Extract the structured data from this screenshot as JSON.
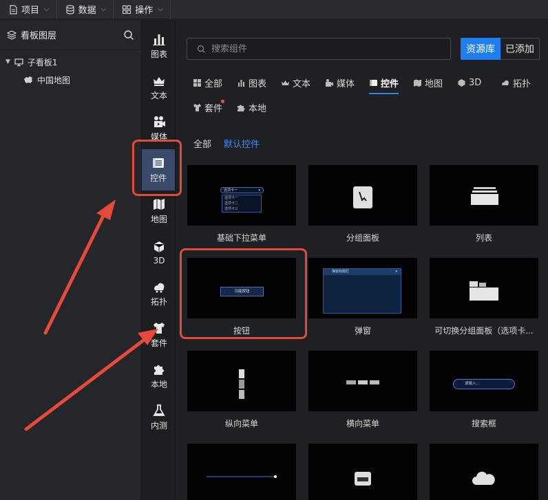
{
  "menubar": {
    "items": [
      {
        "label": "项目",
        "icon": "document-icon"
      },
      {
        "label": "数据",
        "icon": "database-icon"
      },
      {
        "label": "操作",
        "icon": "grid-icon"
      }
    ]
  },
  "layers": {
    "title": "看板图层",
    "tree": [
      {
        "label": "子看板1",
        "icon": "monitor-icon",
        "expanded": true
      },
      {
        "label": "中国地图",
        "icon": "china-map-icon"
      }
    ]
  },
  "rail": {
    "items": [
      {
        "label": "图表",
        "icon": "bar-chart-icon"
      },
      {
        "label": "文本",
        "icon": "crown-text-icon"
      },
      {
        "label": "媒体",
        "icon": "media-icon"
      },
      {
        "label": "控件",
        "icon": "widget-icon",
        "active": true
      },
      {
        "label": "地图",
        "icon": "map-icon"
      },
      {
        "label": "3D",
        "icon": "cube-icon"
      },
      {
        "label": "拓扑",
        "icon": "topology-icon"
      },
      {
        "label": "套件",
        "icon": "shirt-icon"
      },
      {
        "label": "本地",
        "icon": "puzzle-icon"
      },
      {
        "label": "内测",
        "icon": "flask-icon"
      }
    ]
  },
  "search": {
    "placeholder": "搜索组件"
  },
  "source_toggle": {
    "library": "资源库",
    "added": "已添加"
  },
  "tabs": [
    {
      "label": "全部"
    },
    {
      "label": "图表"
    },
    {
      "label": "文本"
    },
    {
      "label": "媒体"
    },
    {
      "label": "控件",
      "active": true
    },
    {
      "label": "地图"
    },
    {
      "label": "3D"
    },
    {
      "label": "拓扑"
    },
    {
      "label": "套件",
      "badge": true
    },
    {
      "label": "本地"
    }
  ],
  "subtabs": [
    {
      "label": "全部"
    },
    {
      "label": "默认控件",
      "active": true
    }
  ],
  "cards": [
    {
      "label": "基础下拉菜单",
      "preview": [
        "选项卡一",
        "选项卡一",
        "选项卡二",
        "选项卡三"
      ]
    },
    {
      "label": "分组面板"
    },
    {
      "label": "列表"
    },
    {
      "label": "按钮",
      "preview": [
        "功能按钮"
      ]
    },
    {
      "label": "弹窗",
      "preview": [
        "弹窗标题栏"
      ]
    },
    {
      "label": "可切换分组面板（选项卡..."
    },
    {
      "label": "纵向菜单"
    },
    {
      "label": "横向菜单"
    },
    {
      "label": "搜索框",
      "preview": [
        "请输入..."
      ]
    },
    {
      "label": ""
    },
    {
      "label": ""
    },
    {
      "label": ""
    }
  ],
  "colors": {
    "accent": "#1f7ef0",
    "annotation": "#e74a3b",
    "rail_active": "#3a4a6b"
  }
}
